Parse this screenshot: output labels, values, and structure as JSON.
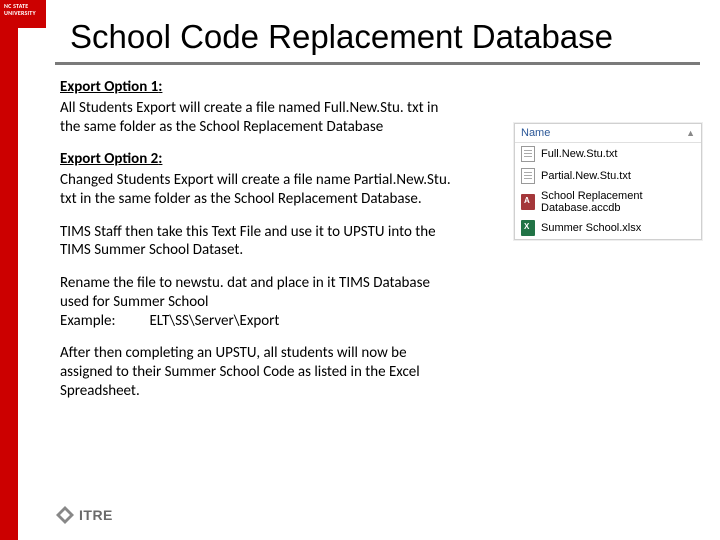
{
  "brand": {
    "line1": "NC STATE",
    "line2": "UNIVERSITY"
  },
  "title": "School Code Replacement Database",
  "option1": {
    "heading": "Export Option 1",
    "body": "All Students Export will create a file named Full.New.Stu. txt in the same folder as the School Replacement Database"
  },
  "option2": {
    "heading": "Export Option 2",
    "body": "Changed Students Export will create a file name Partial.New.Stu. txt in the same folder as the School Replacement Database."
  },
  "para_tims": "TIMS Staff then take this Text File and use it to UPSTU into the TIMS Summer School Dataset.",
  "para_rename": "Rename the file to newstu. dat and place in it TIMS Database used for Summer School",
  "para_example_label": "Example:",
  "para_example_value": "ELT\\SS\\Server\\Export",
  "para_after": "After then completing an UPSTU, all students will now be assigned to their Summer School Code as listed in the Excel Spreadsheet.",
  "explorer": {
    "column_name": "Name",
    "files": [
      {
        "icon": "txt",
        "name": "Full.New.Stu.txt"
      },
      {
        "icon": "txt",
        "name": "Partial.New.Stu.txt"
      },
      {
        "icon": "accdb",
        "name": "School Replacement  Database.accdb"
      },
      {
        "icon": "xlsx",
        "name": "Summer School.xlsx"
      }
    ]
  },
  "footer_logo": "ITRE"
}
